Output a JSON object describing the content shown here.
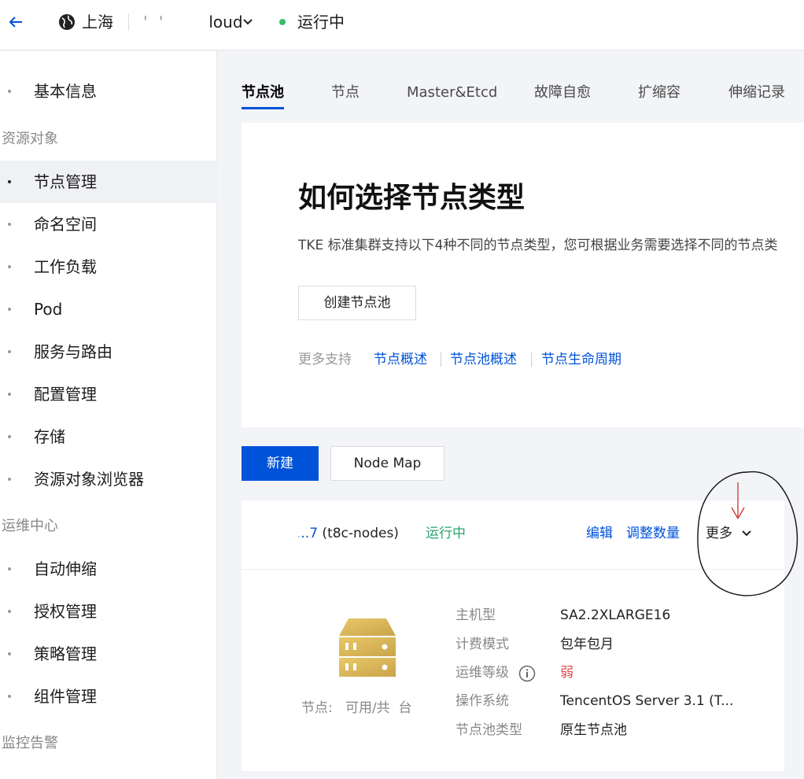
{
  "header": {
    "region": "上海",
    "cluster_name_mask": "' '",
    "cluster_name": "loud",
    "cluster_status": "运行中"
  },
  "sidebar": {
    "basic_info": "基本信息",
    "groups": {
      "resources": "资源对象",
      "ops": "运维中心",
      "monitoring": "监控告警"
    },
    "resources_items": [
      "节点管理",
      "命名空间",
      "工作负载",
      "Pod",
      "服务与路由",
      "配置管理",
      "存储",
      "资源对象浏览器"
    ],
    "ops_items": [
      "自动伸缩",
      "授权管理",
      "策略管理",
      "组件管理"
    ],
    "active_item": "节点管理"
  },
  "tabs": [
    "节点池",
    "节点",
    "Master&Etcd",
    "故障自愈",
    "扩缩容",
    "伸缩记录"
  ],
  "active_tab": "节点池",
  "info_card": {
    "title": "如何选择节点类型",
    "description": "TKE 标准集群支持以下4种不同的节点类型，您可根据业务需要选择不同的节点类",
    "create_button": "创建节点池",
    "more_support_label": "更多支持",
    "links": [
      "节点概述",
      "节点池概述",
      "节点生命周期"
    ]
  },
  "actions": {
    "new_button": "新建",
    "nodemap_button": "Node Map"
  },
  "pool": {
    "name_mask": ".",
    "name_id_end": "..7",
    "name_suffix": " (t8c-nodes)",
    "status": "运行中",
    "edit": "编辑",
    "adjust": "调整数量",
    "more": "更多",
    "nodes_text": "节点:   可用/共  台",
    "properties": [
      {
        "label": "主机型",
        "value": "SA2.2XLARGE16"
      },
      {
        "label": "计费模式",
        "value": "包年包月"
      },
      {
        "label": "运维等级",
        "value": "弱"
      },
      {
        "label": "操作系统",
        "value": "TencentOS Server 3.1 (T..."
      },
      {
        "label": "节点池类型",
        "value": "原生节点池"
      }
    ]
  },
  "colors": {
    "primary": "#0052d9",
    "running": "#2ba471",
    "weak": "#e54545",
    "server_icon": "#d4b24c",
    "annotation": "#d03030"
  }
}
